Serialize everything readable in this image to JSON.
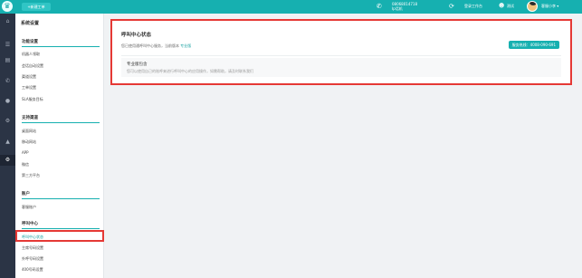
{
  "topbar": {
    "logo_glyph": "♛",
    "new_ticket_label": "+新建工单",
    "phone_number": "08068014718",
    "phone_status": "Ip话机",
    "workbench_label": "登录工作台",
    "test_label": "测试",
    "user_name": "客服小李 ▾",
    "accent_color": "#16b0b0"
  },
  "rail": {
    "icons": [
      "home-icon",
      "list-icon",
      "document-icon",
      "phone-icon",
      "user-icon",
      "gear-icon",
      "chart-icon",
      "settings-icon"
    ]
  },
  "sidebar": {
    "title": "系统设置",
    "groups": [
      {
        "label": "功能设置",
        "items": [
          "机器人领取",
          "会话自动设置",
          "渠道设置",
          "工单设置",
          "SLA服务目标"
        ]
      },
      {
        "label": "支持渠道",
        "items": [
          "桌面网站",
          "移动网站",
          "APP",
          "微信",
          "第三方平台"
        ]
      },
      {
        "label": "账户",
        "items": [
          "客服账户"
        ]
      },
      {
        "label": "呼叫中心",
        "items": [
          "呼叫中心状态",
          "主席号码设置",
          "外呼号码设置",
          "400号码设置"
        ]
      }
    ],
    "active_item": "呼叫中心状态"
  },
  "main": {
    "title": "呼叫中心状态",
    "subtitle": "您已使用通呼叫中心服务，当前版本",
    "subtitle_link": "专业版",
    "hotline": "服务热线：4008-090-691",
    "service_title": "专业版包含",
    "service_desc": "您可以使用自己的账呼来进行呼叫中心的应用操作，如需帮助，请及时联系我们"
  }
}
